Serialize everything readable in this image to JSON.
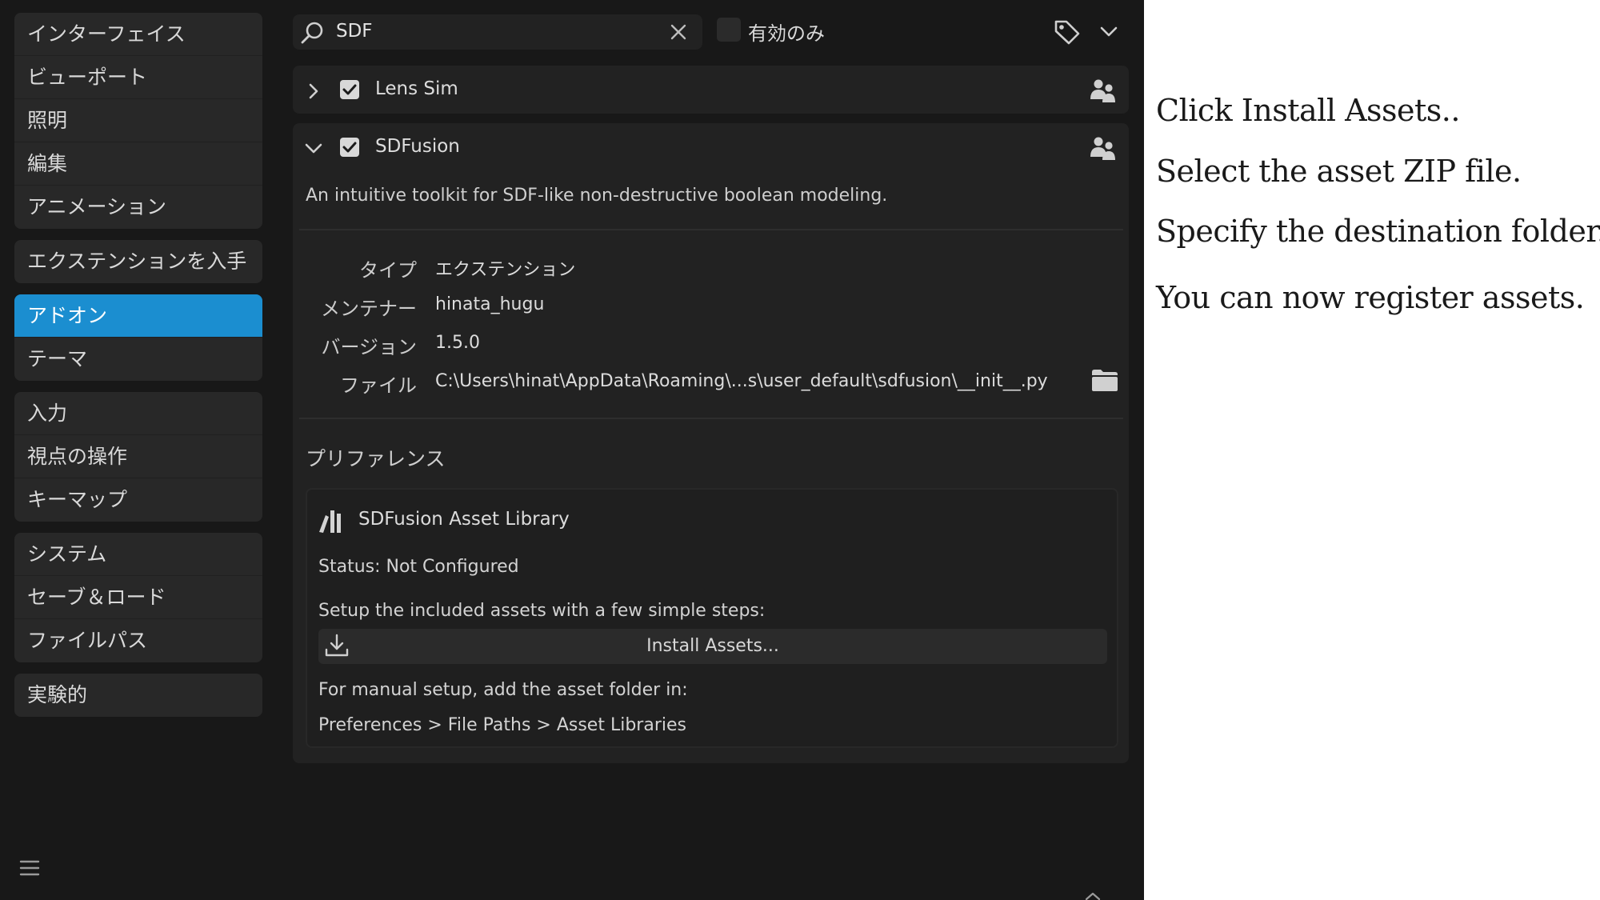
{
  "sidebar": {
    "groups": [
      {
        "items": [
          "インターフェイス",
          "ビューポート",
          "照明",
          "編集",
          "アニメーション"
        ]
      },
      {
        "items": [
          "エクステンションを入手"
        ]
      },
      {
        "items": [
          "アドオン",
          "テーマ"
        ]
      },
      {
        "items": [
          "入力",
          "視点の操作",
          "キーマップ"
        ]
      },
      {
        "items": [
          "システム",
          "セーブ＆ロード",
          "ファイルパス"
        ]
      },
      {
        "items": [
          "実験的"
        ]
      }
    ],
    "active_item": "アドオン"
  },
  "search": {
    "value": "SDF"
  },
  "filter": {
    "only_enabled_label": "有効のみ",
    "only_enabled_checked": false
  },
  "addons": [
    {
      "name": "Lens Sim",
      "enabled": true,
      "expanded": false
    },
    {
      "name": "SDFusion",
      "enabled": true,
      "expanded": true,
      "description": "An intuitive toolkit for SDF-like non-destructive boolean modeling.",
      "info": [
        {
          "label": "タイプ",
          "value": "エクステンション"
        },
        {
          "label": "メンテナー",
          "value": "hinata_hugu"
        },
        {
          "label": "バージョン",
          "value": "1.5.0"
        },
        {
          "label": "ファイル",
          "value": "C:\\Users\\hinat\\AppData\\Roaming\\...s\\user_default\\sdfusion\\__init__.py"
        }
      ],
      "preferences": {
        "title": "プリファレンス",
        "library_title": "SDFusion Asset Library",
        "status": "Status: Not Configured",
        "setup_text": "Setup the included assets with a few simple steps:",
        "install_label": "Install Assets...",
        "manual_text": "For manual setup, add the asset folder in:",
        "manual_path": "Preferences > File Paths > Asset Libraries"
      }
    }
  ],
  "instructions": [
    "Click Install Assets..",
    "Select the asset ZIP file.",
    "Specify the destination folder.",
    "You can now register assets."
  ],
  "colors": {
    "accent": "#1b8ed0",
    "background": "#181818",
    "panel": "#222222"
  },
  "icons": [
    "search-icon",
    "close-icon",
    "tag-icon",
    "chevron-down-icon",
    "chevron-right-icon",
    "checkbox-icon",
    "users-icon",
    "folder-icon",
    "library-icon",
    "download-icon",
    "hamburger-icon",
    "chevron-up-icon"
  ]
}
